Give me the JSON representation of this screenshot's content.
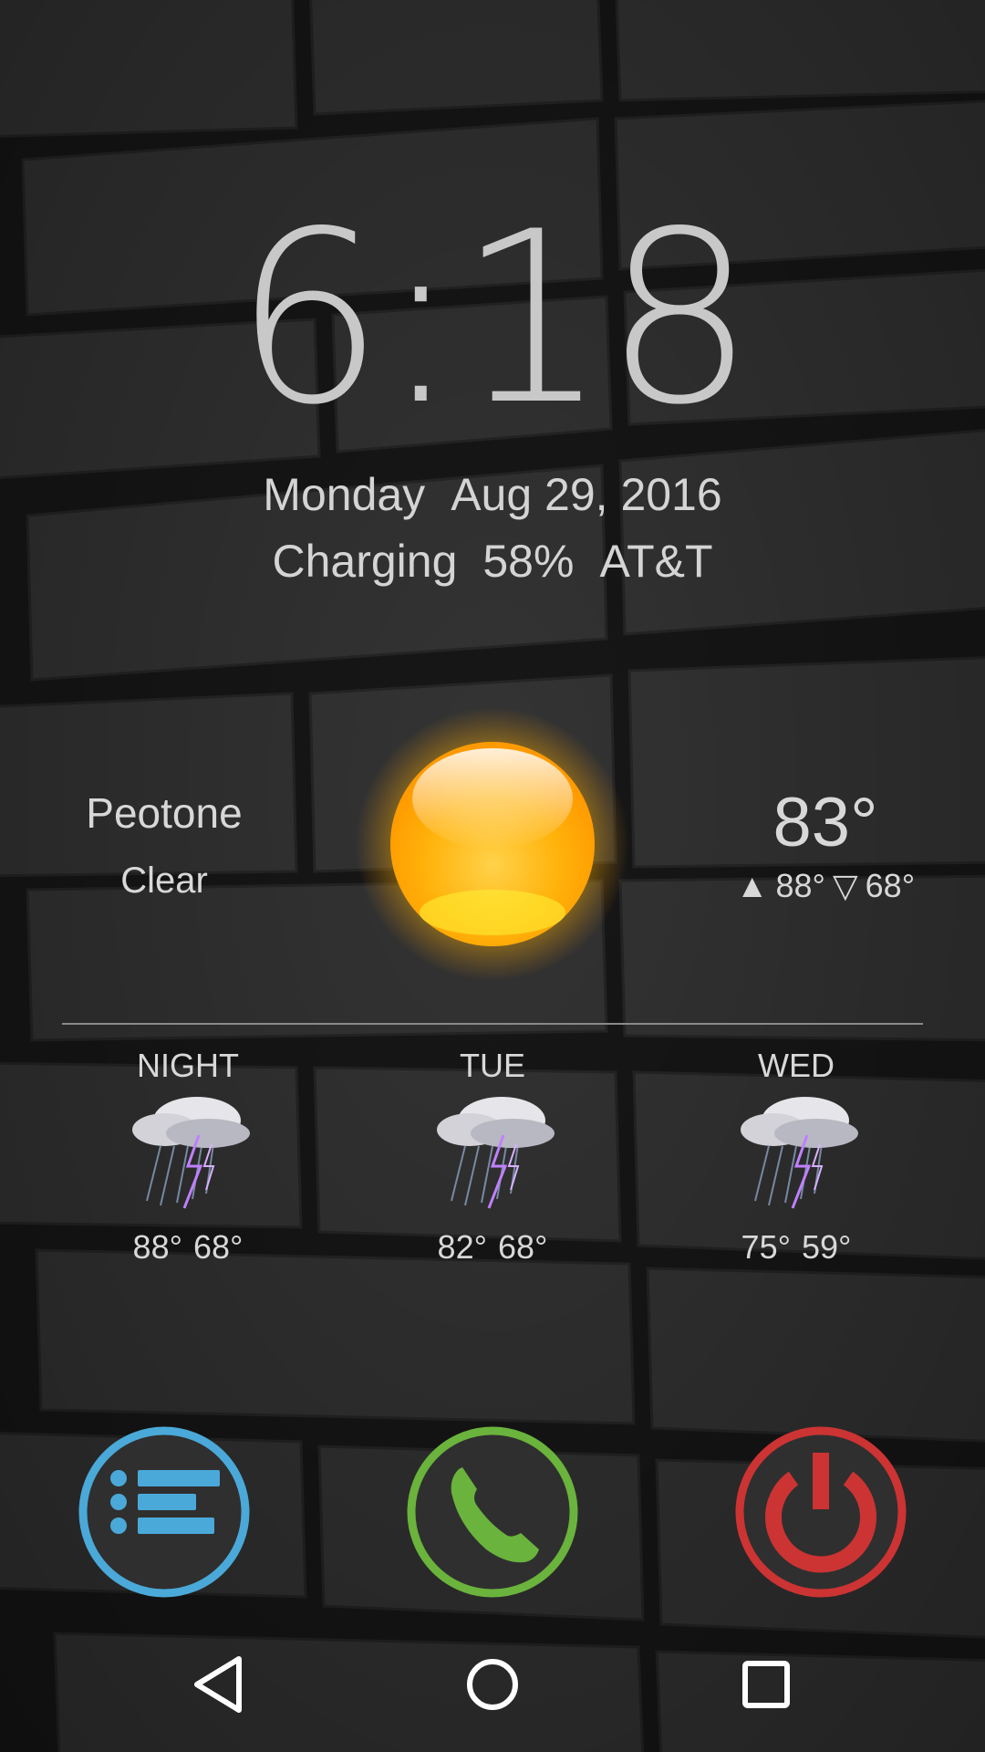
{
  "clock": {
    "time": "6:18"
  },
  "date": {
    "weekday": "Monday",
    "date": "Aug 29, 2016"
  },
  "status": {
    "charging": "Charging",
    "battery": "58%",
    "carrier": "AT&T"
  },
  "weather": {
    "location": "Peotone",
    "condition": "Clear",
    "current_temp": "83°",
    "high": "88°",
    "low": "68°",
    "icon": "sun-icon"
  },
  "forecast": [
    {
      "day": "NIGHT",
      "high": "88°",
      "low": "68°",
      "icon": "thunderstorm-icon"
    },
    {
      "day": "TUE",
      "high": "82°",
      "low": "68°",
      "icon": "thunderstorm-icon"
    },
    {
      "day": "WED",
      "high": "75°",
      "low": "59°",
      "icon": "thunderstorm-icon"
    }
  ],
  "shortcuts": [
    {
      "name": "menu",
      "icon": "list-icon",
      "color": "#4aa9d8"
    },
    {
      "name": "phone",
      "icon": "phone-icon",
      "color": "#6ab33c"
    },
    {
      "name": "power",
      "icon": "power-icon",
      "color": "#cc3333"
    }
  ],
  "navbar": {
    "back": "back-icon",
    "home": "home-icon",
    "recents": "recents-icon"
  }
}
